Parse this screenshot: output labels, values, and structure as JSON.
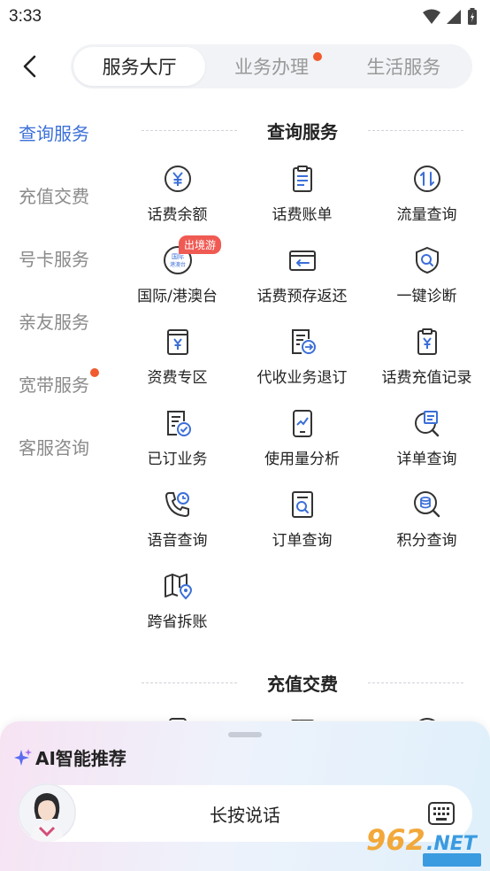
{
  "status": {
    "time": "3:33"
  },
  "header": {
    "tabs": [
      {
        "label": "服务大厅",
        "active": true,
        "dot": false
      },
      {
        "label": "业务办理",
        "active": false,
        "dot": true
      },
      {
        "label": "生活服务",
        "active": false,
        "dot": false
      }
    ]
  },
  "sidebar": {
    "items": [
      {
        "label": "查询服务",
        "active": true
      },
      {
        "label": "充值交费"
      },
      {
        "label": "号卡服务"
      },
      {
        "label": "亲友服务"
      },
      {
        "label": "宽带服务",
        "dot": true
      },
      {
        "label": "客服咨询"
      }
    ]
  },
  "sections": {
    "query": {
      "title": "查询服务",
      "items": [
        {
          "label": "话费余额",
          "icon": "yen-circle-icon"
        },
        {
          "label": "话费账单",
          "icon": "clipboard-list-icon"
        },
        {
          "label": "流量查询",
          "icon": "data-arrows-icon"
        },
        {
          "label": "国际/港澳台",
          "icon": "international-badge-icon",
          "badge": "出境游",
          "icon_text": "国际港澳台"
        },
        {
          "label": "话费预存返还",
          "icon": "card-return-icon"
        },
        {
          "label": "一键诊断",
          "icon": "shield-search-icon"
        },
        {
          "label": "资费专区",
          "icon": "tariff-book-icon"
        },
        {
          "label": "代收业务退订",
          "icon": "doc-arrow-icon"
        },
        {
          "label": "话费充值记录",
          "icon": "recharge-record-icon"
        },
        {
          "label": "已订业务",
          "icon": "doc-check-icon"
        },
        {
          "label": "使用量分析",
          "icon": "phone-chart-icon"
        },
        {
          "label": "详单查询",
          "icon": "doc-search-icon"
        },
        {
          "label": "语音查询",
          "icon": "phone-clock-icon"
        },
        {
          "label": "订单查询",
          "icon": "order-search-icon"
        },
        {
          "label": "积分查询",
          "icon": "points-search-icon"
        },
        {
          "label": "跨省拆账",
          "icon": "map-pin-icon"
        }
      ]
    },
    "recharge": {
      "title": "充值交费"
    }
  },
  "ai": {
    "title": "AI智能推荐",
    "voice_text": "长按说话"
  },
  "colors": {
    "accent": "#3b6fd8",
    "dot": "#f05a2e",
    "badge": "#ef5a53"
  }
}
